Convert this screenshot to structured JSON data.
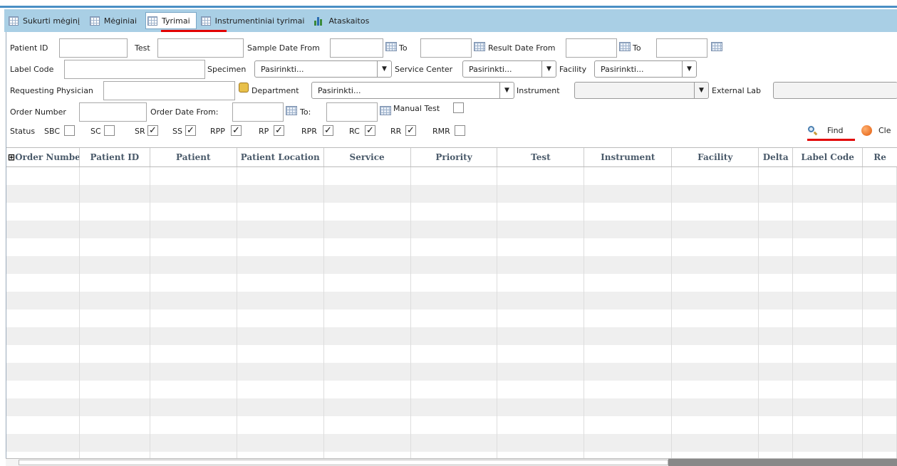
{
  "tabs": [
    {
      "label": "Sukurti mėginį",
      "icon": "grid-icon"
    },
    {
      "label": "Mėginiai",
      "icon": "grid-icon"
    },
    {
      "label": "Tyrimai",
      "icon": "grid-icon",
      "active": true
    },
    {
      "label": "Instrumentiniai tyrimai",
      "icon": "grid-icon"
    },
    {
      "label": "Ataskaitos",
      "icon": "bar-chart-icon"
    }
  ],
  "filters": {
    "patient_id": "Patient ID",
    "test": "Test",
    "sample_date_from": "Sample Date From",
    "to1": "To",
    "result_date_from": "Result Date From",
    "to2": "To",
    "label_code": "Label Code",
    "specimen": "Specimen",
    "specimen_value": "Pasirinkti...",
    "service_center": "Service Center",
    "service_center_value": "Pasirinkti...",
    "facility": "Facility",
    "facility_value": "Pasirinkti...",
    "requesting_physician": "Requesting Physician",
    "department": "Department",
    "department_value": "Pasirinkti...",
    "instrument": "Instrument",
    "instrument_value": "",
    "external_lab": "External Lab",
    "order_number": "Order Number",
    "order_date_from": "Order Date From:",
    "to3": "To:",
    "manual_test": "Manual Test"
  },
  "status": {
    "label": "Status",
    "items": [
      {
        "label": "SBC",
        "checked": false
      },
      {
        "label": "SC",
        "checked": false
      },
      {
        "label": "SR",
        "checked": true
      },
      {
        "label": "SS",
        "checked": true
      },
      {
        "label": "RPP",
        "checked": true
      },
      {
        "label": "RP",
        "checked": true
      },
      {
        "label": "RPR",
        "checked": true
      },
      {
        "label": "RC",
        "checked": true
      },
      {
        "label": "RR",
        "checked": true
      },
      {
        "label": "RMR",
        "checked": false
      }
    ]
  },
  "actions": {
    "find": "Find",
    "clear": "Cle"
  },
  "table": {
    "expand_glyph": "⊞",
    "columns": [
      "Order Number",
      "Patient ID",
      "Patient",
      "Patient Location",
      "Service",
      "Priority",
      "Test",
      "Instrument",
      "Facility",
      "Delta",
      "Label Code",
      "Re"
    ]
  },
  "colors": {
    "tabbar": "#a9cfe5",
    "accent_underline": "#e20000"
  }
}
